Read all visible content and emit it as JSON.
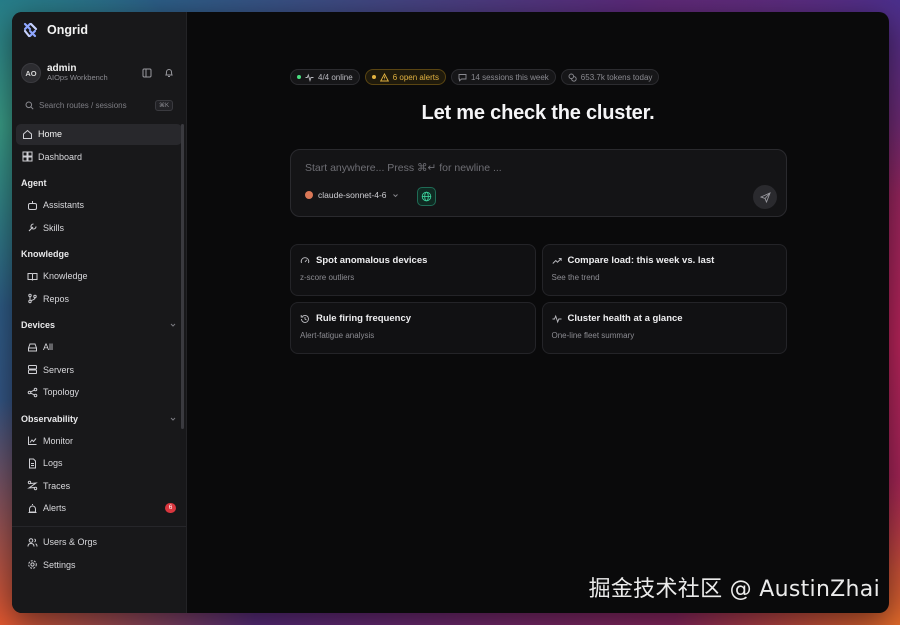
{
  "app": {
    "name": "Ongrid"
  },
  "user": {
    "initials": "AO",
    "name": "admin",
    "subtitle": "AIOps Workbench"
  },
  "search": {
    "placeholder": "Search routes / sessions",
    "shortcut": "⌘K"
  },
  "nav": {
    "home": "Home",
    "dashboard": "Dashboard"
  },
  "sections": {
    "agent": {
      "title": "Agent",
      "items": [
        "Assistants",
        "Skills"
      ]
    },
    "knowledge": {
      "title": "Knowledge",
      "items": [
        "Knowledge",
        "Repos"
      ]
    },
    "devices": {
      "title": "Devices",
      "items": [
        "All",
        "Servers",
        "Topology"
      ]
    },
    "observability": {
      "title": "Observability",
      "items": [
        "Monitor",
        "Logs",
        "Traces",
        "Alerts"
      ],
      "alerts_badge": "6"
    }
  },
  "footer": {
    "users_orgs": "Users & Orgs",
    "settings": "Settings"
  },
  "status": {
    "online": "4/4 online",
    "alerts": "6 open alerts",
    "sessions": "14 sessions this week",
    "tokens": "653.7k tokens today",
    "online_color": "#4ade80",
    "alert_color": "#e3b341"
  },
  "headline": "Let me check the cluster.",
  "composer": {
    "placeholder": "Start anywhere... Press ⌘↵ for newline ...",
    "model": "claude-sonnet-4-6"
  },
  "suggestions": [
    {
      "title": "Spot anomalous devices",
      "subtitle": "z-score outliers",
      "icon": "gauge-icon"
    },
    {
      "title": "Compare load: this week vs. last",
      "subtitle": "See the trend",
      "icon": "trend-icon"
    },
    {
      "title": "Rule firing frequency",
      "subtitle": "Alert-fatigue analysis",
      "icon": "history-icon"
    },
    {
      "title": "Cluster health at a glance",
      "subtitle": "One-line fleet summary",
      "icon": "pulse-icon"
    }
  ],
  "watermark": "掘金技术社区 @ AustinZhai"
}
